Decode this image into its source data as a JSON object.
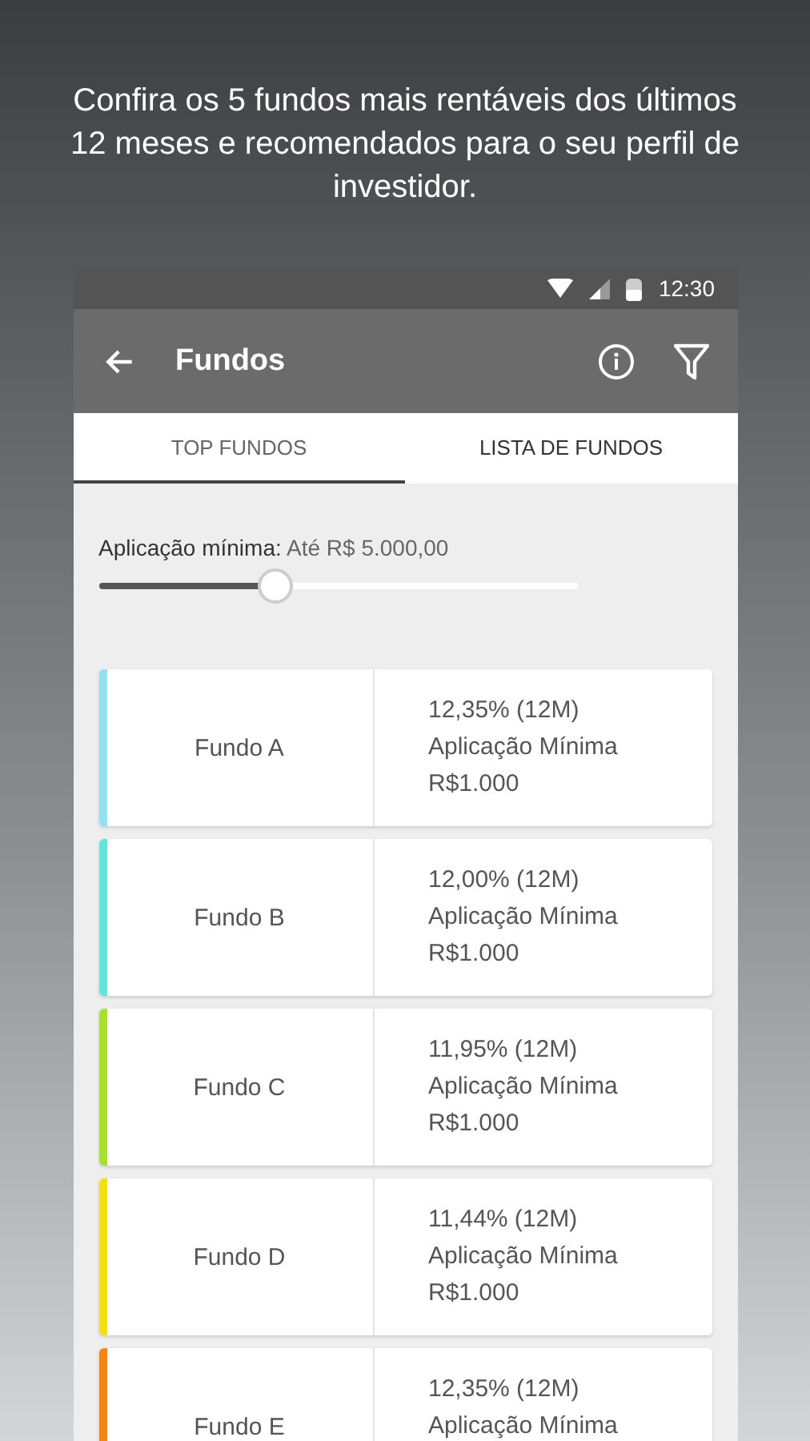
{
  "headline": "Confira os 5 fundos mais rentáveis dos últimos 12 meses e recomendados para o seu perfil de investidor.",
  "status_bar": {
    "time": "12:30"
  },
  "app_bar": {
    "title": "Fundos"
  },
  "tabs": [
    {
      "label": "TOP FUNDOS",
      "selected": true
    },
    {
      "label": "LISTA DE FUNDOS",
      "selected": false
    }
  ],
  "filter": {
    "label": "Aplicação mínima:",
    "value": "Até R$ 5.000,00",
    "level": 0.37
  },
  "funds": [
    {
      "name": "Fundo A",
      "color": "#8fe3f5",
      "lines": [
        "12,35% (12M)",
        "Aplicação Mínima",
        "R$1.000"
      ]
    },
    {
      "name": "Fundo B",
      "color": "#5ee6d8",
      "lines": [
        "12,00% (12M)",
        "Aplicação Mínima",
        "R$1.000"
      ]
    },
    {
      "name": "Fundo C",
      "color": "#a6e22a",
      "lines": [
        "11,95% (12M)",
        "Aplicação Mínima",
        "R$1.000"
      ]
    },
    {
      "name": "Fundo D",
      "color": "#f5e10a",
      "lines": [
        "11,44% (12M)",
        "Aplicação Mínima",
        "R$1.000"
      ]
    },
    {
      "name": "Fundo E",
      "color": "#f5870f",
      "lines": [
        "12,35% (12M)",
        "Aplicação Mínima"
      ]
    }
  ]
}
